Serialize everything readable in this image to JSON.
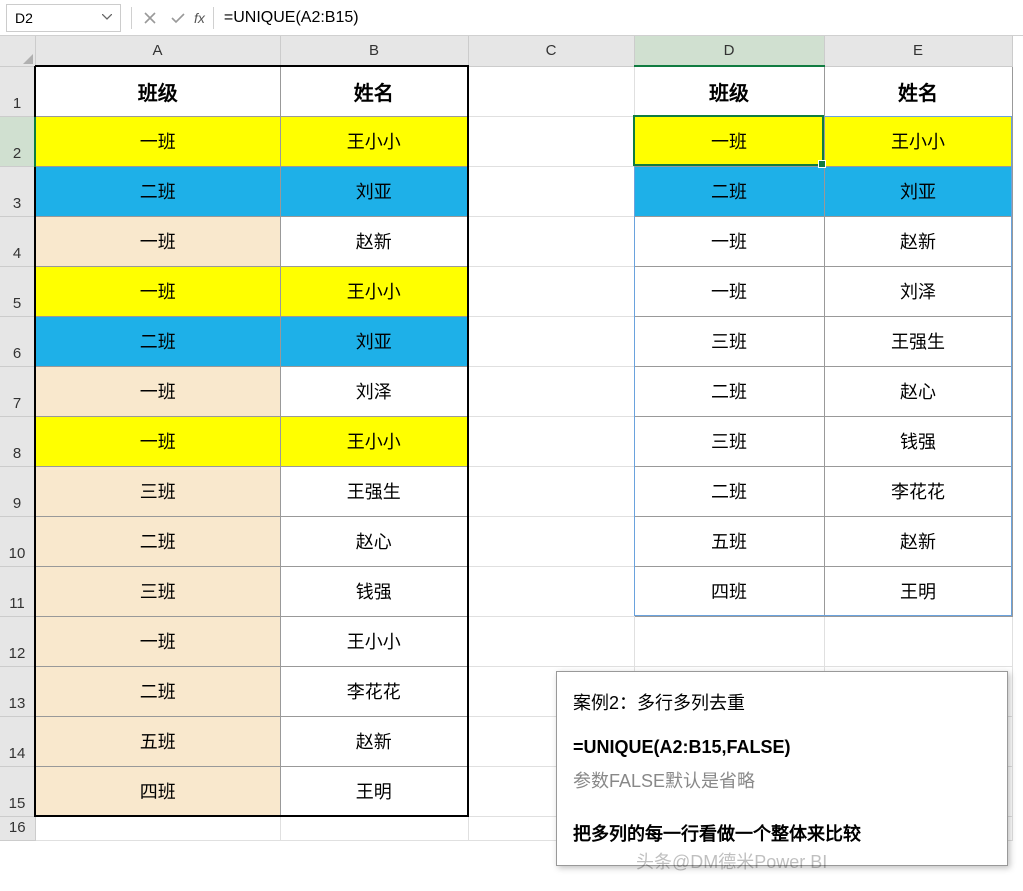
{
  "formulaBar": {
    "cellRef": "D2",
    "formula": "=UNIQUE(A2:B15)",
    "fx": "fx"
  },
  "columns": [
    "A",
    "B",
    "C",
    "D",
    "E"
  ],
  "rowHeaders": [
    "1",
    "2",
    "3",
    "4",
    "5",
    "6",
    "7",
    "8",
    "9",
    "10",
    "11",
    "12",
    "13",
    "14",
    "15",
    "16"
  ],
  "headersAB": {
    "A": "班级",
    "B": "姓名"
  },
  "headersDE": {
    "D": "班级",
    "E": "姓名"
  },
  "tableAB": [
    {
      "A": "一班",
      "B": "王小小",
      "cls": "bg-yellow"
    },
    {
      "A": "二班",
      "B": "刘亚",
      "cls": "bg-blue"
    },
    {
      "A": "一班",
      "B": "赵新",
      "clsA": "bg-beige"
    },
    {
      "A": "一班",
      "B": "王小小",
      "cls": "bg-yellow"
    },
    {
      "A": "二班",
      "B": "刘亚",
      "cls": "bg-blue"
    },
    {
      "A": "一班",
      "B": "刘泽",
      "clsA": "bg-beige"
    },
    {
      "A": "一班",
      "B": "王小小",
      "cls": "bg-yellow"
    },
    {
      "A": "三班",
      "B": "王强生",
      "clsA": "bg-beige"
    },
    {
      "A": "二班",
      "B": "赵心",
      "clsA": "bg-beige"
    },
    {
      "A": "三班",
      "B": "钱强",
      "clsA": "bg-beige"
    },
    {
      "A": "一班",
      "B": "王小小",
      "clsA": "bg-beige"
    },
    {
      "A": "二班",
      "B": "李花花",
      "clsA": "bg-beige"
    },
    {
      "A": "五班",
      "B": "赵新",
      "clsA": "bg-beige"
    },
    {
      "A": "四班",
      "B": "王明",
      "clsA": "bg-beige"
    }
  ],
  "tableDE": [
    {
      "D": "一班",
      "E": "王小小",
      "cls": "bg-yellow"
    },
    {
      "D": "二班",
      "E": "刘亚",
      "cls": "bg-blue"
    },
    {
      "D": "一班",
      "E": "赵新"
    },
    {
      "D": "一班",
      "E": "刘泽"
    },
    {
      "D": "三班",
      "E": "王强生"
    },
    {
      "D": "二班",
      "E": "赵心"
    },
    {
      "D": "三班",
      "E": "钱强"
    },
    {
      "D": "二班",
      "E": "李花花"
    },
    {
      "D": "五班",
      "E": "赵新"
    },
    {
      "D": "四班",
      "E": "王明"
    }
  ],
  "note": {
    "line1": "案例2：多行多列去重",
    "line2": "=UNIQUE(A2:B15,FALSE)",
    "line3": "参数FALSE默认是省略",
    "line4": "把多列的每一行看做一个整体来比较"
  },
  "watermark": "头条@DM德米Power BI",
  "activeCol": "D",
  "activeRow": "2"
}
